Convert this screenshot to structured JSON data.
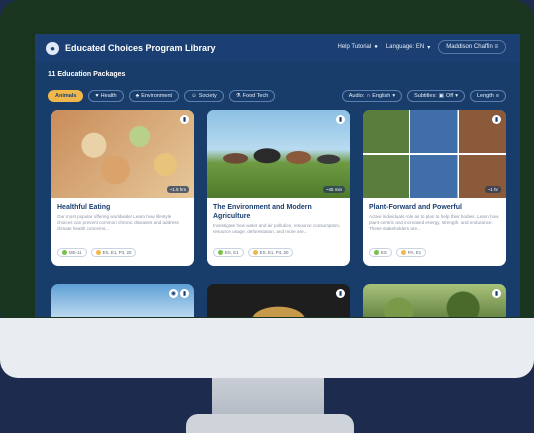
{
  "app": {
    "title": "Educated Choices Program Library",
    "help_label": "Help Tutorial",
    "language_label": "Language: EN",
    "user_label": "Maddison Chaffin"
  },
  "package_count": "11 Education Packages",
  "filters": {
    "chips": [
      {
        "label": "Animals",
        "icon": "paw-icon",
        "active": true
      },
      {
        "label": "Health",
        "icon": "heart-icon"
      },
      {
        "label": "Environment",
        "icon": "leaf-icon"
      },
      {
        "label": "Society",
        "icon": "people-icon"
      },
      {
        "label": "Food Tech",
        "icon": "flask-icon"
      }
    ],
    "audio_label": "Audio:",
    "audio_value": "English",
    "subtitles_label": "Subtitles:",
    "subtitles_value": "Off",
    "length_label": "Length"
  },
  "cards": [
    {
      "title": "Healthful Eating",
      "description": "Our most popular offering worldwide! Learn how lifestyle choices can prevent common chronic diseases and address climate health concerns...",
      "duration": "~1.5 hrs",
      "tags": [
        "MS-11",
        "ES, E1, P4, 20"
      ],
      "thumb_colors": [
        "#c98c5a",
        "#e7c89a"
      ]
    },
    {
      "title": "The Environment and Modern Agriculture",
      "description": "Investigate how water and air pollution, resource consumption, resource usage, deforestation, and more are...",
      "duration": "~45 min",
      "tags": [
        "ES, E1",
        "ES, E1, P4, 20"
      ],
      "thumb_colors": [
        "#7fb5dc",
        "#5f8a3a"
      ]
    },
    {
      "title": "Plant-Forward and Powerful",
      "description": "Active individuals role as to plan to help their bodies. Learn how plant-centric and increased energy, strength, and endurance. These stakeholders are...",
      "duration": "~1 hr",
      "tags": [
        "ES",
        "PA, E1"
      ],
      "thumb_colors": [
        "#a87a55",
        "#3f6e9f"
      ]
    }
  ],
  "row2_colors": [
    [
      "#5fa0d6",
      "#cfe4f5"
    ],
    [
      "#1e1e1e",
      "#c69a4a"
    ],
    [
      "#5c7a3c",
      "#a8c27a"
    ]
  ]
}
